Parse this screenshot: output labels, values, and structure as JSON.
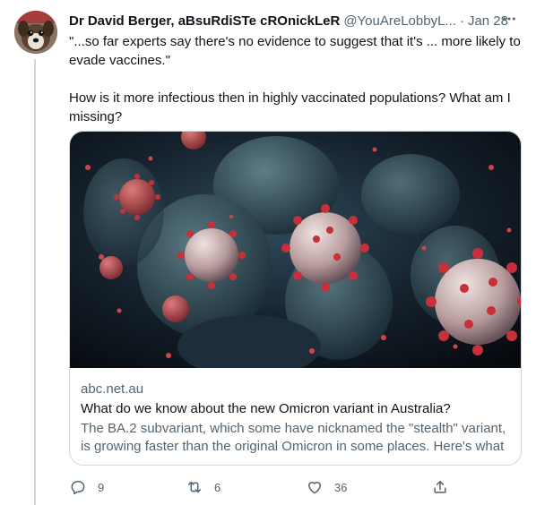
{
  "tweet": {
    "display_name": "Dr David Berger, aBsuRdiSTe cROnickLeR",
    "handle": "@YouAreLobbyL...",
    "separator": "·",
    "date": "Jan 28",
    "text_paragraph_1": "\"...so far experts say there's no evidence to suggest that it's ... more likely to evade vaccines.\"",
    "text_paragraph_2": "How is it more infectious then in highly vaccinated populations? What am I missing?"
  },
  "card": {
    "domain": "abc.net.au",
    "title": "What do we know about the new Omicron variant in Australia?",
    "description": "The BA.2 subvariant, which some have nicknamed the \"stealth\" variant, is growing faster than the original Omicron in some places. Here's what ..."
  },
  "actions": {
    "reply_count": "9",
    "retweet_count": "6",
    "like_count": "36"
  },
  "icons": {
    "more": "more-icon",
    "reply": "reply-icon",
    "retweet": "retweet-icon",
    "like": "like-icon",
    "share": "share-icon"
  },
  "colors": {
    "text_primary": "#0f1419",
    "text_secondary": "#536471",
    "border": "#cfd9de",
    "virus_red": "#c5303a"
  }
}
